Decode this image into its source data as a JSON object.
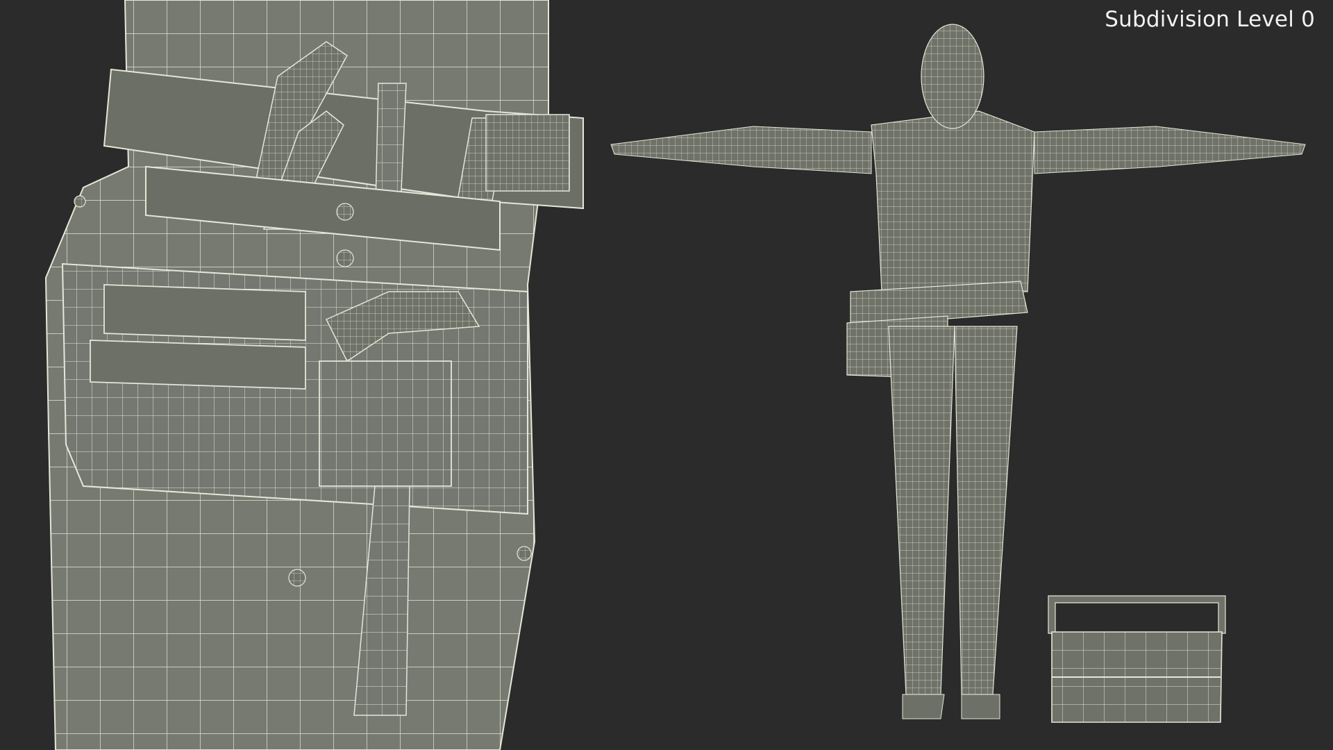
{
  "render": {
    "label": "Subdivision Level 0"
  },
  "colors": {
    "background": "#2b2b2b",
    "mesh_fill": "#777a70",
    "mesh_dark": "#555850",
    "wire": "#e6e6d8"
  },
  "icons": {
    "closeup": "tool-belt-closeup",
    "figure": "worker-figure",
    "toolbox": "toolbox"
  }
}
